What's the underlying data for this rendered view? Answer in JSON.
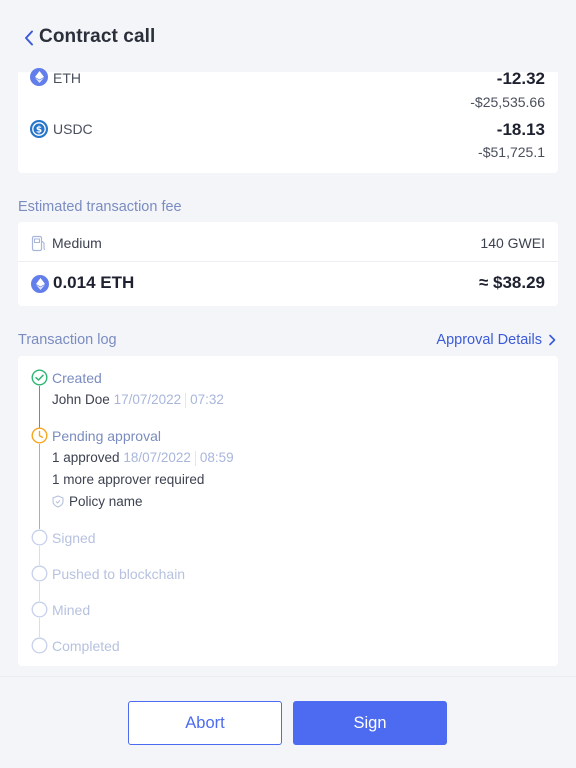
{
  "header": {
    "title": "Contract call"
  },
  "assets": [
    {
      "symbol": "ETH",
      "amount": "-12.32",
      "fiat": "-$25,535.66",
      "icon": "eth-icon"
    },
    {
      "symbol": "USDC",
      "amount": "-18.13",
      "fiat": "-$51,725.1",
      "icon": "usdc-icon"
    }
  ],
  "fee": {
    "label": "Estimated transaction fee",
    "speed": "Medium",
    "gas": "140 GWEI",
    "amount": "0.014 ETH",
    "fiat": "≈ $38.29"
  },
  "log": {
    "label": "Transaction log",
    "details_link": "Approval Details",
    "created": {
      "label": "Created",
      "user": "John Doe",
      "date": "17/07/2022",
      "time": "07:32"
    },
    "pending": {
      "label": "Pending approval",
      "approved": "1 approved",
      "date": "18/07/2022",
      "time": "08:59",
      "more": "1 more approver required",
      "policy": "Policy name"
    },
    "upcoming": [
      "Signed",
      "Pushed to blockchain",
      "Mined",
      "Completed"
    ]
  },
  "actions": {
    "abort": "Abort",
    "sign": "Sign"
  },
  "colors": {
    "accent": "#4c6bf0",
    "success": "#2bb673",
    "pending": "#f5a623",
    "muted": "#a9b6dc",
    "eth": "#627eea",
    "usdc": "#2775ca"
  }
}
